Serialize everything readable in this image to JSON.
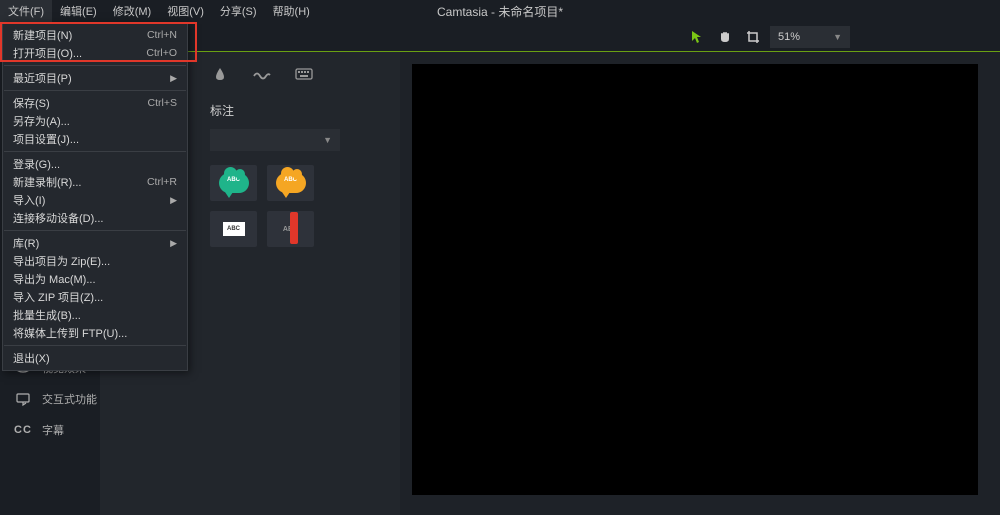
{
  "app_title": "Camtasia - 未命名项目*",
  "menubar": [
    "文件(F)",
    "编辑(E)",
    "修改(M)",
    "视图(V)",
    "分享(S)",
    "帮助(H)"
  ],
  "dropdown": [
    {
      "label": "新建项目(N)",
      "shortcut": "Ctrl+N"
    },
    {
      "label": "打开项目(O)...",
      "shortcut": "Ctrl+O"
    },
    {
      "label": "最近项目(P)",
      "sub": true,
      "sep_before": true
    },
    {
      "label": "保存(S)",
      "shortcut": "Ctrl+S",
      "sep_before": true
    },
    {
      "label": "另存为(A)..."
    },
    {
      "label": "项目设置(J)..."
    },
    {
      "label": "登录(G)...",
      "sep_before": true
    },
    {
      "label": "新建录制(R)...",
      "shortcut": "Ctrl+R"
    },
    {
      "label": "导入(I)",
      "sub": true
    },
    {
      "label": "连接移动设备(D)..."
    },
    {
      "label": "库(R)",
      "sub": true,
      "sep_before": true
    },
    {
      "label": "导出项目为 Zip(E)..."
    },
    {
      "label": "导出为 Mac(M)..."
    },
    {
      "label": "导入 ZIP 项目(Z)..."
    },
    {
      "label": "批量生成(B)..."
    },
    {
      "label": "将媒体上传到 FTP(U)..."
    },
    {
      "label": "退出(X)",
      "sep_before": true
    }
  ],
  "zoom": "51%",
  "mid_title": "标注",
  "thumb_text": "ABC",
  "sidebar": [
    {
      "icon": "eye",
      "label": "视觉效果"
    },
    {
      "icon": "interact",
      "label": "交互式功能"
    },
    {
      "icon": "cc",
      "label": "字幕"
    }
  ]
}
